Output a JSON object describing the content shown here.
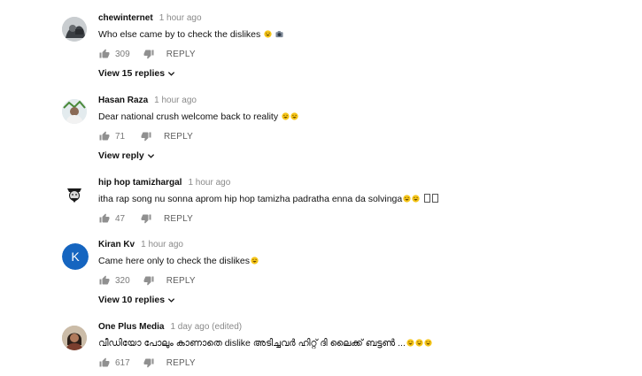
{
  "comments": [
    {
      "author": "chewinternet",
      "time": "1 hour ago",
      "text": "Who else came by to check the dislikes",
      "likes": "309",
      "reply_label": "REPLY",
      "view_replies": "View 15 replies"
    },
    {
      "author": "Hasan Raza",
      "time": "1 hour ago",
      "text": "Dear national crush welcome back to reality",
      "likes": "71",
      "reply_label": "REPLY",
      "view_replies": "View reply"
    },
    {
      "author": "hip hop tamizhargal",
      "time": "1 hour ago",
      "text": "itha rap song nu sonna aprom hip hop tamizha padratha enna da solvinga",
      "likes": "47",
      "reply_label": "REPLY"
    },
    {
      "author": "Kiran Kv",
      "time": "1 hour ago",
      "text": "Came here only to check the dislikes",
      "likes": "320",
      "reply_label": "REPLY",
      "view_replies": "View 10 replies",
      "avatar_letter": "K",
      "avatar_color": "#1565c0"
    },
    {
      "author": "One Plus Media",
      "time": "1 day ago (edited)",
      "text": "വീഡിയോ പോലും കാണാതെ dislike അടിച്ചവർ ഹിറ്റ് ദി ലൈക്ക് ബട്ടൺ ...",
      "likes": "617",
      "reply_label": "REPLY"
    }
  ],
  "colors": {
    "meta_gray": "#8a8a8a",
    "icon_gray": "#909090",
    "emoji_yellow": "#f5c518"
  }
}
